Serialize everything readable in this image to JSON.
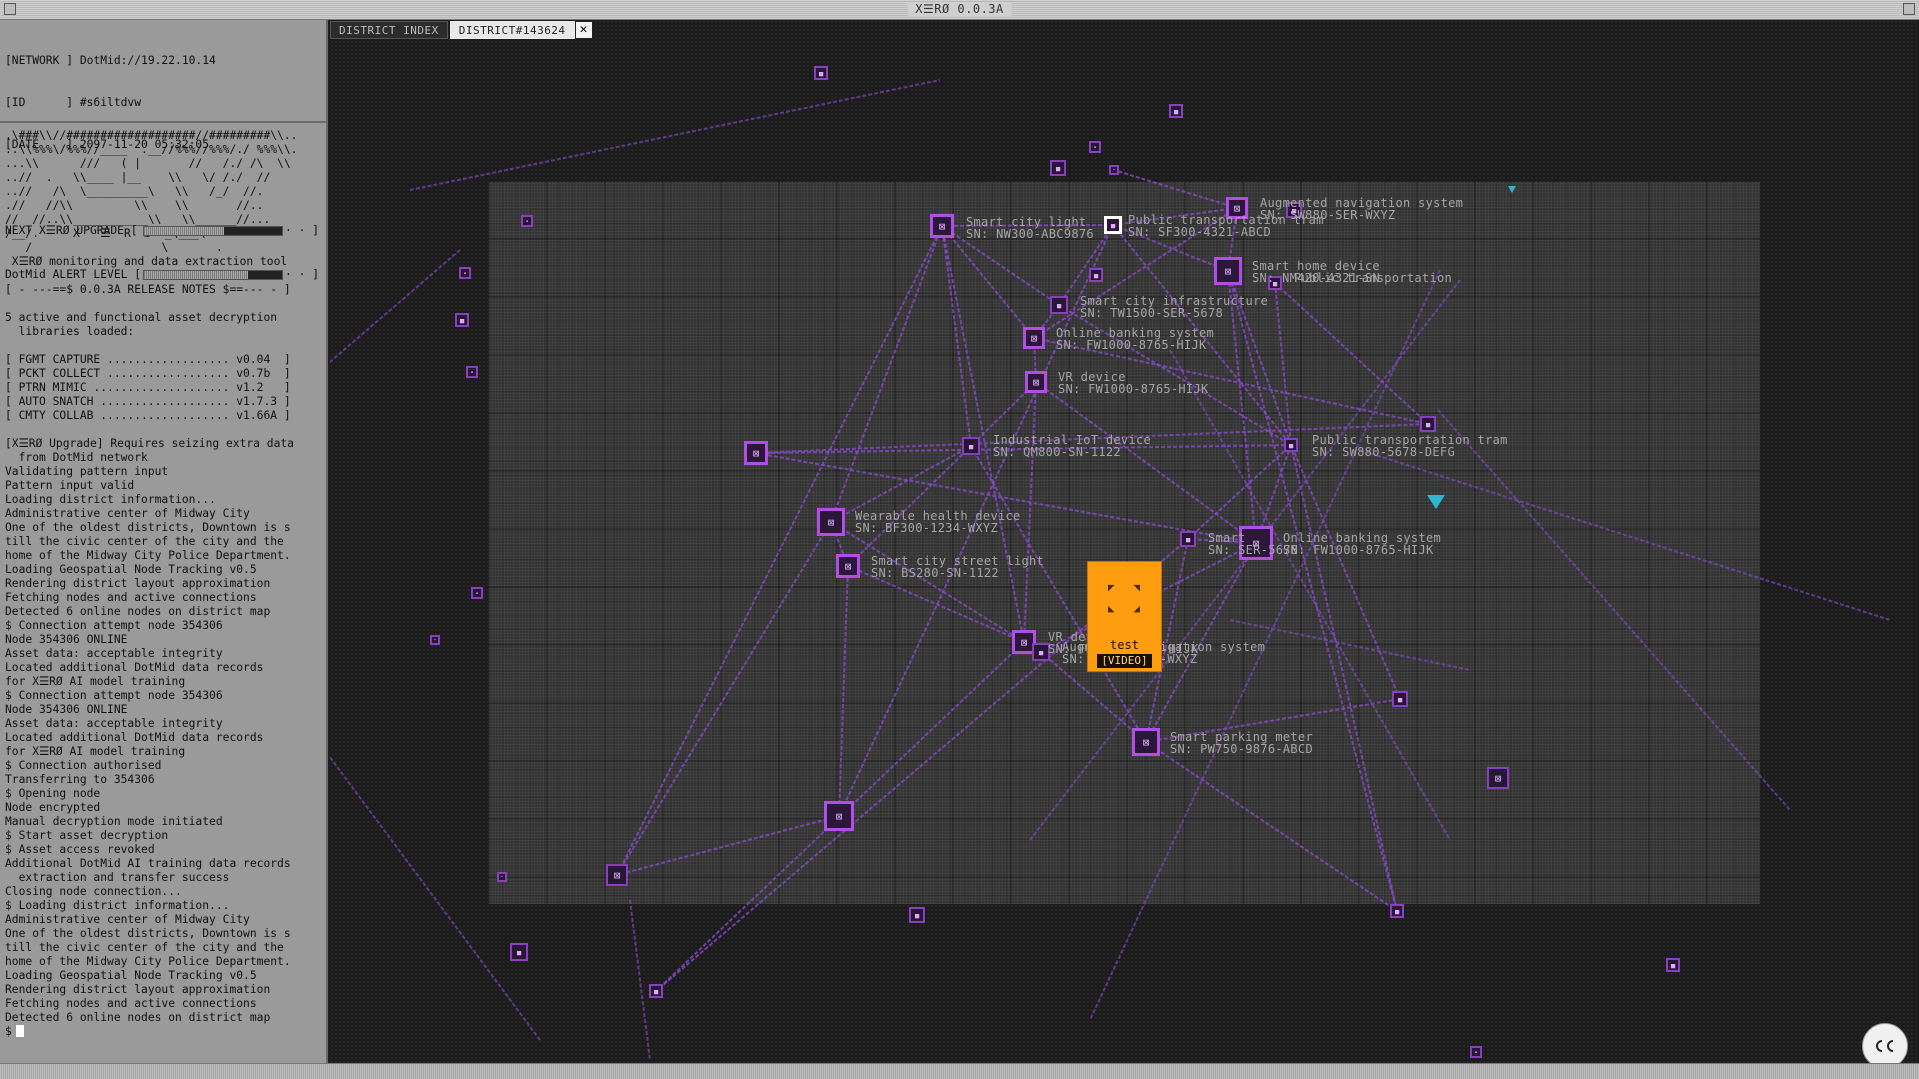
{
  "window": {
    "title": "X☰RØ 0.0.3A"
  },
  "tabs": [
    {
      "label": "DISTRICT INDEX"
    },
    {
      "label": "DISTRICT#143624"
    }
  ],
  "status": {
    "network": "[NETWORK ] DotMid://19.22.10.14",
    "id": "[ID      ] #s6iltdvw",
    "date": "[DATE    ] 2097-11-20 05:32:05",
    "upgrade_label": "NEXT X☰RØ UPGRADE [",
    "upgrade_level": 0.42,
    "alert_label": "DotMid ALERT LEVEL [",
    "alert_level": 0.25,
    "bar_end": "· · ]"
  },
  "log": [
    ".\\###\\\\//###################//#########\\\\..",
    "..\\\\%%%\\/%%%//____  .__//%%%//%%%/./ %%%\\\\.",
    "...\\\\      ///   ( |       //   /./ /\\  \\\\",
    "..//  .   \\\\____ |__    \\\\   \\/ /./  //",
    "..//   /\\  \\_________\\   \\\\   /_/  //.",
    ".//   //\\\\         \\\\    \\\\       //..",
    "//  //..\\\\___________\\\\   \\\\______//...",
    "/__/.     X   ☰  R  Ø  _\\___\\",
    "   /                   \\       .",
    " X☰RØ monitoring and data extraction tool",
    "",
    "[ - ---==$ 0.0.3A RELEASE NOTES $==--- - ]",
    "",
    "5 active and functional asset decryption",
    "  libraries loaded:",
    "",
    "[ FGMT CAPTURE .................. v0.04  ]",
    "[ PCKT COLLECT .................. v0.7b  ]",
    "[ PTRN MIMIC .................... v1.2   ]",
    "[ AUTO SNATCH ................... v1.7.3 ]",
    "[ CMTY COLLAB ................... v1.66A ]",
    "",
    "[X☰RØ Upgrade] Requires seizing extra data",
    "  from DotMid network",
    "Validating pattern input",
    "Pattern input valid",
    "Loading district information...",
    "Administrative center of Midway City",
    "One of the oldest districts, Downtown is s",
    "till the civic center of the city and the",
    "home of the Midway City Police Department.",
    "Loading Geospatial Node Tracking v0.5",
    "Rendering district layout approximation",
    "Fetching nodes and active connections",
    "Detected 6 online nodes on district map",
    "$ Connection attempt node 354306",
    "Node 354306 ONLINE",
    "Asset data: acceptable integrity",
    "Located additional DotMid data records",
    "for X☰RØ AI model training",
    "$ Connection attempt node 354306",
    "Node 354306 ONLINE",
    "Asset data: acceptable integrity",
    "Located additional DotMid data records",
    "for X☰RØ AI model training",
    "$ Connection authorised",
    "Transferring to 354306",
    "$ Opening node",
    "Node encrypted",
    "Manual decryption mode initiated",
    "$ Start asset decryption",
    "$ Asset access revoked",
    "Additional DotMid AI training data records",
    "  extraction and transfer success",
    "Closing node connection...",
    "$ Loading district information...",
    "Administrative center of Midway City",
    "One of the oldest districts, Downtown is s",
    "till the civic center of the city and the",
    "home of the Midway City Police Department.",
    "Loading Geospatial Node Tracking v0.5",
    "Rendering district layout approximation",
    "Fetching nodes and active connections",
    "Detected 6 online nodes on district map"
  ],
  "prompt": "$",
  "nodes": [
    {
      "name": "Smart city light",
      "sn": "SN: NW300-ABC9876"
    },
    {
      "name": "Public transportation tram",
      "sn": "SN: SF300-4321-ABCD"
    },
    {
      "name": "Augmented navigation system",
      "sn": "SN: SW880-SER-WXYZ"
    },
    {
      "name": "Smart home device",
      "sn": "SN: NM420-4321-SN"
    },
    {
      "name": "Public transportation",
      "sn": ""
    },
    {
      "name": "Smart city infrastructure",
      "sn": "SN: TW1500-SER-5678"
    },
    {
      "name": "Online banking system",
      "sn": "SN: FW1000-8765-HIJK"
    },
    {
      "name": "VR device",
      "sn": "SN: FW1000-8765-HIJK"
    },
    {
      "name": "Industrial IoT device",
      "sn": "SN: QM800-SN-1122"
    },
    {
      "name": "Public transportation tram",
      "sn": "SN: SW880-5678-DEFG"
    },
    {
      "name": "Wearable health device",
      "sn": "SN: BF300-1234-WXYZ"
    },
    {
      "name": "Smart city street light",
      "sn": "SN: BS280-SN-1122"
    },
    {
      "name": "Online banking system",
      "sn": "SN: FW1000-8765-HIJK"
    },
    {
      "name": "Smart",
      "sn": "SN: SER-5678"
    },
    {
      "name": "VR device",
      "sn": "SN: FW1000-8765-HIJK"
    },
    {
      "name": "Augmented navigation system",
      "sn": "SN: SW880-SER-WXYZ"
    },
    {
      "name": "Smart parking meter",
      "sn": "SN: PW750-9876-ABCD"
    }
  ],
  "video": {
    "title": "test",
    "tag": "[VIDEO]"
  },
  "colors": {
    "node": "#b04ee6",
    "edge": "#8b4bd1",
    "accent": "#ff9d10",
    "marker": "#2fb5cf",
    "terminal_bg": "#9a9a9a"
  },
  "icons": {
    "close": "close-icon",
    "cc": "closed-captions-icon",
    "expand": "expand-arrows-icon"
  }
}
